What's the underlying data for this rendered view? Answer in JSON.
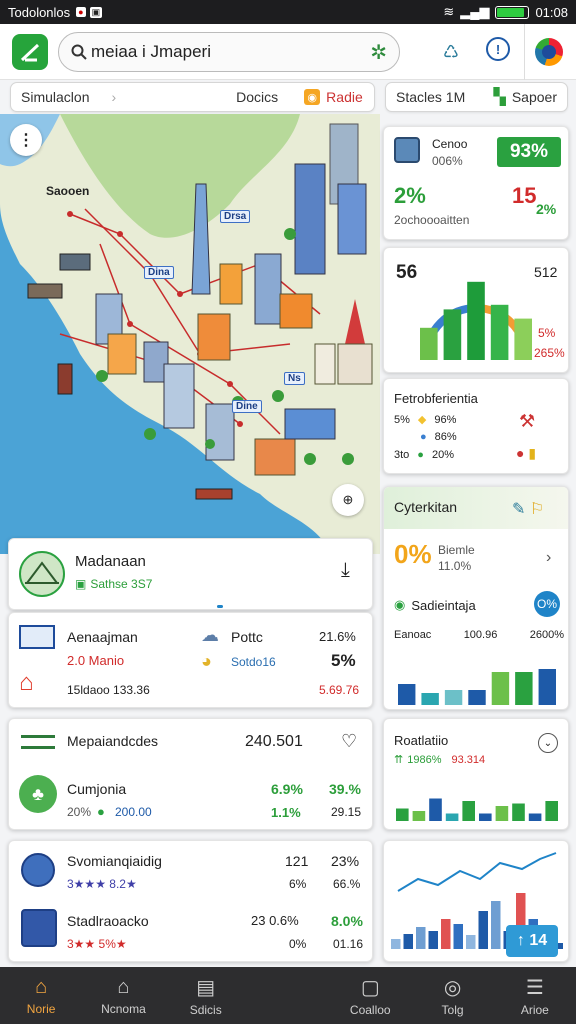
{
  "status": {
    "left_text": "Todolonlos",
    "time": "01:08"
  },
  "header": {
    "search_value": "meiaa i Jmaperi"
  },
  "subbar": {
    "sim_label": "Simulaclon",
    "docks_label": "Docics",
    "radio_label": "Radie",
    "stacks_label": "Stacles  1M",
    "sapoer_label": "Sapoer"
  },
  "map": {
    "city_label": "Saooen",
    "tags": [
      "Drsa",
      "Dina",
      "Ns",
      "Dine"
    ]
  },
  "stat_card_1": {
    "title": "Cenoo",
    "sub": "006%",
    "badge": "93%",
    "left_val": "2%",
    "right_val": "15",
    "right_pct": "2%",
    "caption": "2ochoooaitten"
  },
  "gauge_card": {
    "left_num": "56",
    "right_num": "512",
    "pct_a": "5%",
    "pct_b": "265%",
    "bars": [
      35,
      55,
      85,
      60,
      45
    ]
  },
  "legend_card": {
    "title": "Fetrobferientia",
    "rows": [
      {
        "k": "5%",
        "v": "96%"
      },
      {
        "k": "",
        "v": "86%"
      },
      {
        "k": "3to",
        "v": "20%"
      }
    ]
  },
  "city_card": {
    "title": "Madanaan",
    "sub": "Sathse 3S7"
  },
  "stats_card": {
    "r1_left": "Aenaajman",
    "r1_mid": "Pottc",
    "r1_right": "21.6%",
    "r2_left": "2.0 Manio",
    "r2_mid": "Sotdo16",
    "r2_right": "5%",
    "r3_left": "15ldaoo 133.36",
    "r3_right": "5.69.76"
  },
  "cyber_card": {
    "title": "Cyterkitan",
    "pct": "0%",
    "sub1": "Biemle",
    "sub2": "11.0%",
    "sec_title": "Sadieintaja",
    "sec_badge": "O%",
    "row_a": "Eanoac",
    "row_b": "100.96",
    "row_c": "2600%",
    "bars": [
      35,
      20,
      25,
      25,
      55,
      55,
      60
    ]
  },
  "finance_card": {
    "title": "Mepaiandcdes",
    "value": "240.501",
    "item": "Cumjonia",
    "g1": "6.9%",
    "g2": "39.%",
    "pct": "20%",
    "amt": "200.00",
    "g3": "1.1%",
    "g4": "29.15"
  },
  "radar_card": {
    "title": "Roatlatiio",
    "sub": "1986%",
    "chip": "93.314",
    "bars": [
      25,
      20,
      45,
      15,
      40,
      15,
      30,
      35,
      15,
      40
    ]
  },
  "rank_card": {
    "r1_title": "Svomianqiaidig",
    "r1_a": "121",
    "r1_b": "23%",
    "r1_stars": "3★★★ 8.2★",
    "r1_c": "6%",
    "r1_d": "66.%",
    "r2_title": "Stadlraoacko",
    "r2_a": "23 0.6%",
    "r2_b": "8.0%",
    "r2_stars": "3★★ 5%★",
    "r2_c": "0%",
    "r2_d": "01.16"
  },
  "trend_card": {
    "badge": "↑ 14",
    "bars": [
      10,
      15,
      22,
      18,
      30,
      25,
      14,
      38,
      48,
      18,
      56,
      30,
      10,
      6
    ]
  },
  "nav": {
    "items": [
      {
        "label": "Norie",
        "icon": "home-icon"
      },
      {
        "label": "Ncnoma",
        "icon": "bank-icon"
      },
      {
        "label": "Sdicis",
        "icon": "doc-icon"
      },
      {
        "label": "",
        "icon": ""
      },
      {
        "label": "Coalloo",
        "icon": "cart-icon"
      },
      {
        "label": "Tolg",
        "icon": "globe-icon"
      },
      {
        "label": "Arioe",
        "icon": "menu-icon"
      }
    ]
  }
}
